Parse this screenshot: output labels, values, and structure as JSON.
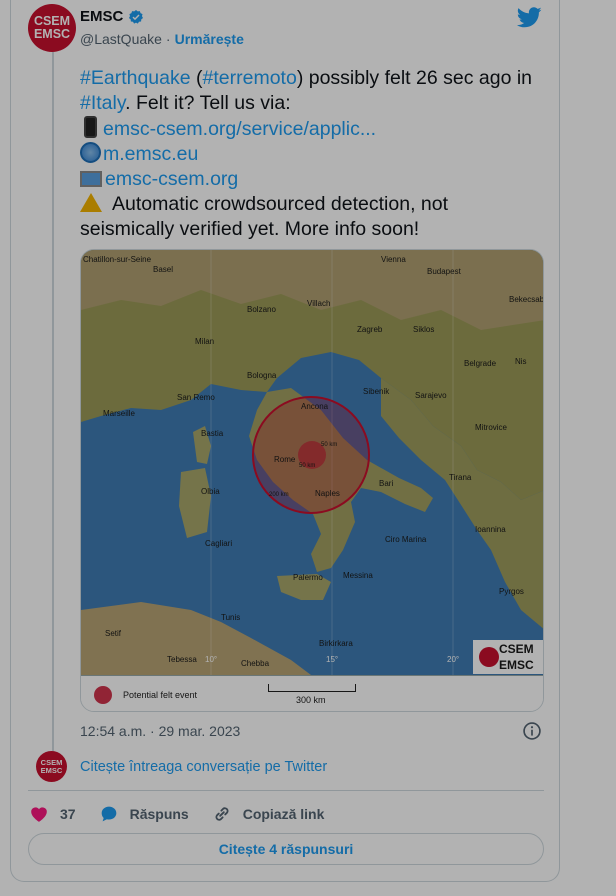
{
  "author": {
    "avatar_text_top": "CSEM",
    "avatar_text_bottom": "EMSC",
    "display_name": "EMSC",
    "handle": "@LastQuake",
    "separator": "·",
    "follow_label": "Urmărește"
  },
  "tweet": {
    "hashtag_earthquake": "#Earthquake",
    "paren_open": " (",
    "hashtag_terremoto": "#terremoto",
    "text_felt": ") possibly felt 26 sec ago in",
    "hashtag_italy": "#Italy",
    "text_tell": ". Felt it? Tell us via:",
    "link_app": "emsc-csem.org/service/applic...",
    "link_mobile": "m.emsc.eu",
    "link_site": "emsc-csem.org",
    "text_auto_1": "Automatic crowdsourced detection, not",
    "text_auto_2": "seismically verified yet. More info soon!"
  },
  "map": {
    "cities": [
      "Chatillon-sur-Seine",
      "Basel",
      "Vienna",
      "Budapest",
      "Bolzano",
      "Villach",
      "Bekecsaba",
      "Milan",
      "Zagreb",
      "Siklos",
      "Belgrade",
      "Bologna",
      "Nis",
      "Marseille",
      "San Remo",
      "Sibenik",
      "Sarajevo",
      "Ancona",
      "Bastia",
      "Mitrovice",
      "Rome",
      "Olbia",
      "Naples",
      "Bari",
      "Tirana",
      "Ciro Marina",
      "Ioannina",
      "Cagliari",
      "Palermo",
      "Messina",
      "Pyrgos",
      "Tunis",
      "Setif",
      "Birkirkara",
      "Tebessa",
      "Chebba"
    ],
    "ring_labels": [
      "50 km",
      "50 km",
      "200 km"
    ],
    "graticule": [
      "10°",
      "15°",
      "20°"
    ],
    "logo_top": "CSEM",
    "logo_bottom": "EMSC",
    "legend_label": "Potential felt event",
    "scale_label": "300 km"
  },
  "meta": {
    "timestamp": "12:54 a.m. · 29 mar. 2023",
    "read_conversation": "Citește întreaga conversație pe Twitter"
  },
  "actions": {
    "like_count": "37",
    "reply_label": "Răspuns",
    "copy_label": "Copiază link",
    "read_replies_label": "Citește 4 răspunsuri"
  },
  "colors": {
    "accent": "#1d9bf0",
    "like": "#f91880",
    "brand_red": "#c8102e"
  }
}
